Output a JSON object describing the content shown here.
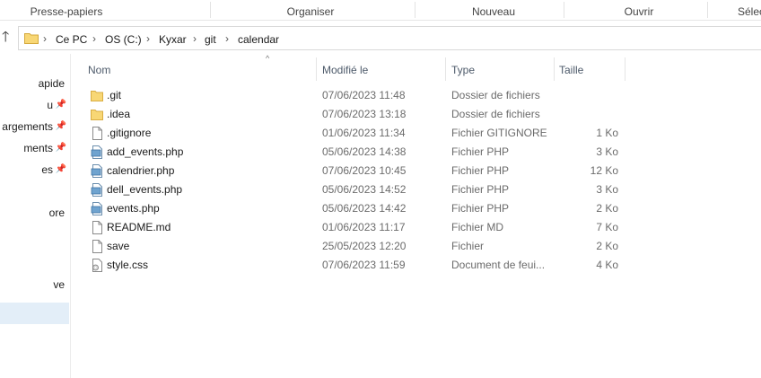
{
  "ribbon": {
    "groups": [
      "Presse-papiers",
      "Organiser",
      "Nouveau",
      "Ouvrir",
      "Sélec"
    ]
  },
  "address": {
    "crumbs": [
      "Ce PC",
      "OS (C:)",
      "Kyxar",
      "git",
      "calendar"
    ]
  },
  "nav": {
    "items": [
      {
        "label": "apide",
        "pinned": false
      },
      {
        "label": "u",
        "pinned": true
      },
      {
        "label": "argements",
        "pinned": true
      },
      {
        "label": "ments",
        "pinned": true
      },
      {
        "label": "es",
        "pinned": true
      },
      {
        "label": "",
        "pinned": false
      },
      {
        "label": "ore",
        "pinned": false
      },
      {
        "label": "",
        "pinned": false
      },
      {
        "label": "",
        "pinned": false
      },
      {
        "label": "ve",
        "pinned": false
      }
    ]
  },
  "columns": {
    "name": "Nom",
    "modified": "Modifié le",
    "type": "Type",
    "size": "Taille"
  },
  "files": [
    {
      "name": ".git",
      "modified": "07/06/2023 11:48",
      "type": "Dossier de fichiers",
      "size": "",
      "icon": "folder"
    },
    {
      "name": ".idea",
      "modified": "07/06/2023 13:18",
      "type": "Dossier de fichiers",
      "size": "",
      "icon": "folder"
    },
    {
      "name": ".gitignore",
      "modified": "01/06/2023 11:34",
      "type": "Fichier GITIGNORE",
      "size": "1 Ko",
      "icon": "file"
    },
    {
      "name": "add_events.php",
      "modified": "05/06/2023 14:38",
      "type": "Fichier PHP",
      "size": "3 Ko",
      "icon": "php"
    },
    {
      "name": "calendrier.php",
      "modified": "07/06/2023 10:45",
      "type": "Fichier PHP",
      "size": "12 Ko",
      "icon": "php"
    },
    {
      "name": "dell_events.php",
      "modified": "05/06/2023 14:52",
      "type": "Fichier PHP",
      "size": "3 Ko",
      "icon": "php"
    },
    {
      "name": "events.php",
      "modified": "05/06/2023 14:42",
      "type": "Fichier PHP",
      "size": "2 Ko",
      "icon": "php"
    },
    {
      "name": "README.md",
      "modified": "01/06/2023 11:17",
      "type": "Fichier MD",
      "size": "7 Ko",
      "icon": "file"
    },
    {
      "name": "save",
      "modified": "25/05/2023 12:20",
      "type": "Fichier",
      "size": "2 Ko",
      "icon": "file"
    },
    {
      "name": "style.css",
      "modified": "07/06/2023 11:59",
      "type": "Document de feui...",
      "size": "4 Ko",
      "icon": "css"
    }
  ],
  "colors": {
    "folder": "#f8d775",
    "selection": "#cce0f2",
    "header_text": "#4d5a6a"
  }
}
